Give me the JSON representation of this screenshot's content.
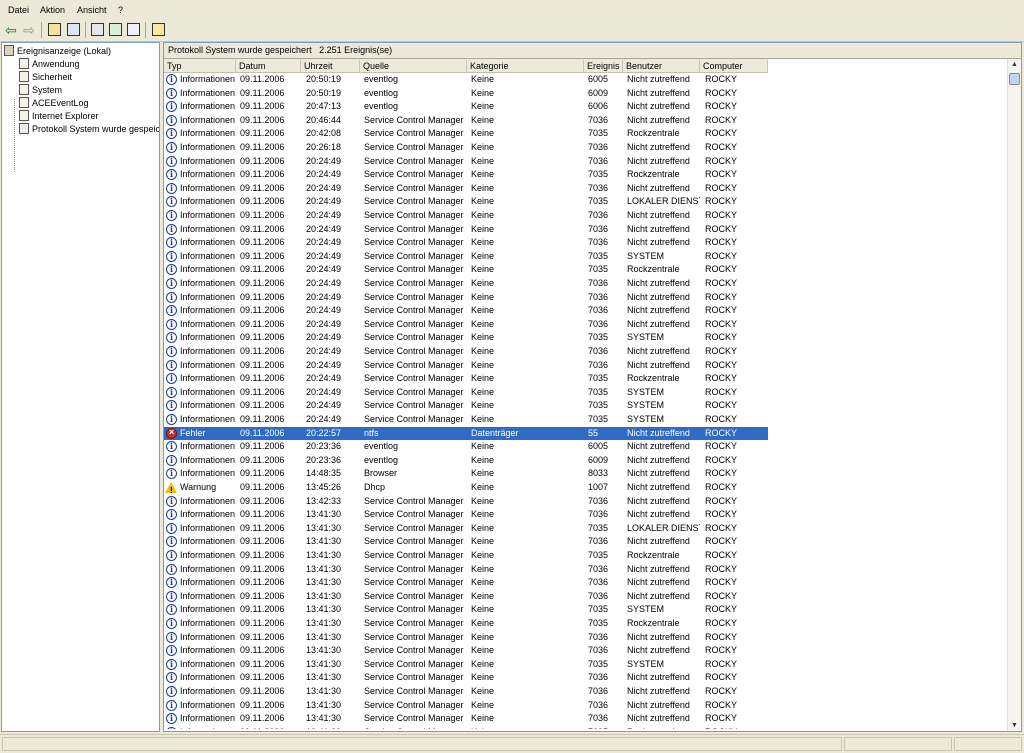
{
  "menu": [
    "Datei",
    "Aktion",
    "Ansicht",
    "?"
  ],
  "toolbar_icons": [
    "back-arrow-icon",
    "forward-arrow-icon",
    "up-folder-icon",
    "show-hide-tree-icon",
    "properties-icon",
    "refresh-icon",
    "export-list-icon",
    "help-icon"
  ],
  "tree": {
    "root": "Ereignisanzeige (Lokal)",
    "items": [
      "Anwendung",
      "Sicherheit",
      "System",
      "ACEEventLog",
      "Internet Explorer",
      "Protokoll System wurde gespeich"
    ]
  },
  "panel": {
    "title": "Protokoll System wurde gespeichert",
    "count": "2.251 Ereignis(se)"
  },
  "columns": [
    "Typ",
    "Datum",
    "Uhrzeit",
    "Quelle",
    "Kategorie",
    "Ereignis",
    "Benutzer",
    "Computer"
  ],
  "rows": [
    [
      "i",
      "Informationen",
      "09.11.2006",
      "20:50:19",
      "eventlog",
      "Keine",
      "6005",
      "Nicht zutreffend",
      "ROCKY"
    ],
    [
      "i",
      "Informationen",
      "09.11.2006",
      "20:50:19",
      "eventlog",
      "Keine",
      "6009",
      "Nicht zutreffend",
      "ROCKY"
    ],
    [
      "i",
      "Informationen",
      "09.11.2006",
      "20:47:13",
      "eventlog",
      "Keine",
      "6006",
      "Nicht zutreffend",
      "ROCKY"
    ],
    [
      "i",
      "Informationen",
      "09.11.2006",
      "20:46:44",
      "Service Control Manager",
      "Keine",
      "7036",
      "Nicht zutreffend",
      "ROCKY"
    ],
    [
      "i",
      "Informationen",
      "09.11.2006",
      "20:42:08",
      "Service Control Manager",
      "Keine",
      "7035",
      "Rockzentrale",
      "ROCKY"
    ],
    [
      "i",
      "Informationen",
      "09.11.2006",
      "20:26:18",
      "Service Control Manager",
      "Keine",
      "7036",
      "Nicht zutreffend",
      "ROCKY"
    ],
    [
      "i",
      "Informationen",
      "09.11.2006",
      "20:24:49",
      "Service Control Manager",
      "Keine",
      "7036",
      "Nicht zutreffend",
      "ROCKY"
    ],
    [
      "i",
      "Informationen",
      "09.11.2006",
      "20:24:49",
      "Service Control Manager",
      "Keine",
      "7035",
      "Rockzentrale",
      "ROCKY"
    ],
    [
      "i",
      "Informationen",
      "09.11.2006",
      "20:24:49",
      "Service Control Manager",
      "Keine",
      "7036",
      "Nicht zutreffend",
      "ROCKY"
    ],
    [
      "i",
      "Informationen",
      "09.11.2006",
      "20:24:49",
      "Service Control Manager",
      "Keine",
      "7035",
      "LOKALER DIENST",
      "ROCKY"
    ],
    [
      "i",
      "Informationen",
      "09.11.2006",
      "20:24:49",
      "Service Control Manager",
      "Keine",
      "7036",
      "Nicht zutreffend",
      "ROCKY"
    ],
    [
      "i",
      "Informationen",
      "09.11.2006",
      "20:24:49",
      "Service Control Manager",
      "Keine",
      "7036",
      "Nicht zutreffend",
      "ROCKY"
    ],
    [
      "i",
      "Informationen",
      "09.11.2006",
      "20:24:49",
      "Service Control Manager",
      "Keine",
      "7036",
      "Nicht zutreffend",
      "ROCKY"
    ],
    [
      "i",
      "Informationen",
      "09.11.2006",
      "20:24:49",
      "Service Control Manager",
      "Keine",
      "7035",
      "SYSTEM",
      "ROCKY"
    ],
    [
      "i",
      "Informationen",
      "09.11.2006",
      "20:24:49",
      "Service Control Manager",
      "Keine",
      "7035",
      "Rockzentrale",
      "ROCKY"
    ],
    [
      "i",
      "Informationen",
      "09.11.2006",
      "20:24:49",
      "Service Control Manager",
      "Keine",
      "7036",
      "Nicht zutreffend",
      "ROCKY"
    ],
    [
      "i",
      "Informationen",
      "09.11.2006",
      "20:24:49",
      "Service Control Manager",
      "Keine",
      "7036",
      "Nicht zutreffend",
      "ROCKY"
    ],
    [
      "i",
      "Informationen",
      "09.11.2006",
      "20:24:49",
      "Service Control Manager",
      "Keine",
      "7036",
      "Nicht zutreffend",
      "ROCKY"
    ],
    [
      "i",
      "Informationen",
      "09.11.2006",
      "20:24:49",
      "Service Control Manager",
      "Keine",
      "7036",
      "Nicht zutreffend",
      "ROCKY"
    ],
    [
      "i",
      "Informationen",
      "09.11.2006",
      "20:24:49",
      "Service Control Manager",
      "Keine",
      "7035",
      "SYSTEM",
      "ROCKY"
    ],
    [
      "i",
      "Informationen",
      "09.11.2006",
      "20:24:49",
      "Service Control Manager",
      "Keine",
      "7036",
      "Nicht zutreffend",
      "ROCKY"
    ],
    [
      "i",
      "Informationen",
      "09.11.2006",
      "20:24:49",
      "Service Control Manager",
      "Keine",
      "7036",
      "Nicht zutreffend",
      "ROCKY"
    ],
    [
      "i",
      "Informationen",
      "09.11.2006",
      "20:24:49",
      "Service Control Manager",
      "Keine",
      "7035",
      "Rockzentrale",
      "ROCKY"
    ],
    [
      "i",
      "Informationen",
      "09.11.2006",
      "20:24:49",
      "Service Control Manager",
      "Keine",
      "7035",
      "SYSTEM",
      "ROCKY"
    ],
    [
      "i",
      "Informationen",
      "09.11.2006",
      "20:24:49",
      "Service Control Manager",
      "Keine",
      "7035",
      "SYSTEM",
      "ROCKY"
    ],
    [
      "i",
      "Informationen",
      "09.11.2006",
      "20:24:49",
      "Service Control Manager",
      "Keine",
      "7035",
      "SYSTEM",
      "ROCKY"
    ],
    [
      "e",
      "Fehler",
      "09.11.2006",
      "20:22:57",
      "ntfs",
      "Datenträger",
      "55",
      "Nicht zutreffend",
      "ROCKY"
    ],
    [
      "i",
      "Informationen",
      "09.11.2006",
      "20:23:36",
      "eventlog",
      "Keine",
      "6005",
      "Nicht zutreffend",
      "ROCKY"
    ],
    [
      "i",
      "Informationen",
      "09.11.2006",
      "20:23:36",
      "eventlog",
      "Keine",
      "6009",
      "Nicht zutreffend",
      "ROCKY"
    ],
    [
      "i",
      "Informationen",
      "09.11.2006",
      "14:48:35",
      "Browser",
      "Keine",
      "8033",
      "Nicht zutreffend",
      "ROCKY"
    ],
    [
      "w",
      "Warnung",
      "09.11.2006",
      "13:45:26",
      "Dhcp",
      "Keine",
      "1007",
      "Nicht zutreffend",
      "ROCKY"
    ],
    [
      "i",
      "Informationen",
      "09.11.2006",
      "13:42:33",
      "Service Control Manager",
      "Keine",
      "7036",
      "Nicht zutreffend",
      "ROCKY"
    ],
    [
      "i",
      "Informationen",
      "09.11.2006",
      "13:41:30",
      "Service Control Manager",
      "Keine",
      "7036",
      "Nicht zutreffend",
      "ROCKY"
    ],
    [
      "i",
      "Informationen",
      "09.11.2006",
      "13:41:30",
      "Service Control Manager",
      "Keine",
      "7035",
      "LOKALER DIENST",
      "ROCKY"
    ],
    [
      "i",
      "Informationen",
      "09.11.2006",
      "13:41:30",
      "Service Control Manager",
      "Keine",
      "7036",
      "Nicht zutreffend",
      "ROCKY"
    ],
    [
      "i",
      "Informationen",
      "09.11.2006",
      "13:41:30",
      "Service Control Manager",
      "Keine",
      "7035",
      "Rockzentrale",
      "ROCKY"
    ],
    [
      "i",
      "Informationen",
      "09.11.2006",
      "13:41:30",
      "Service Control Manager",
      "Keine",
      "7036",
      "Nicht zutreffend",
      "ROCKY"
    ],
    [
      "i",
      "Informationen",
      "09.11.2006",
      "13:41:30",
      "Service Control Manager",
      "Keine",
      "7036",
      "Nicht zutreffend",
      "ROCKY"
    ],
    [
      "i",
      "Informationen",
      "09.11.2006",
      "13:41:30",
      "Service Control Manager",
      "Keine",
      "7036",
      "Nicht zutreffend",
      "ROCKY"
    ],
    [
      "i",
      "Informationen",
      "09.11.2006",
      "13:41:30",
      "Service Control Manager",
      "Keine",
      "7035",
      "SYSTEM",
      "ROCKY"
    ],
    [
      "i",
      "Informationen",
      "09.11.2006",
      "13:41:30",
      "Service Control Manager",
      "Keine",
      "7035",
      "Rockzentrale",
      "ROCKY"
    ],
    [
      "i",
      "Informationen",
      "09.11.2006",
      "13:41:30",
      "Service Control Manager",
      "Keine",
      "7036",
      "Nicht zutreffend",
      "ROCKY"
    ],
    [
      "i",
      "Informationen",
      "09.11.2006",
      "13:41:30",
      "Service Control Manager",
      "Keine",
      "7036",
      "Nicht zutreffend",
      "ROCKY"
    ],
    [
      "i",
      "Informationen",
      "09.11.2006",
      "13:41:30",
      "Service Control Manager",
      "Keine",
      "7035",
      "SYSTEM",
      "ROCKY"
    ],
    [
      "i",
      "Informationen",
      "09.11.2006",
      "13:41:30",
      "Service Control Manager",
      "Keine",
      "7036",
      "Nicht zutreffend",
      "ROCKY"
    ],
    [
      "i",
      "Informationen",
      "09.11.2006",
      "13:41:30",
      "Service Control Manager",
      "Keine",
      "7036",
      "Nicht zutreffend",
      "ROCKY"
    ],
    [
      "i",
      "Informationen",
      "09.11.2006",
      "13:41:30",
      "Service Control Manager",
      "Keine",
      "7036",
      "Nicht zutreffend",
      "ROCKY"
    ],
    [
      "i",
      "Informationen",
      "09.11.2006",
      "13:41:30",
      "Service Control Manager",
      "Keine",
      "7036",
      "Nicht zutreffend",
      "ROCKY"
    ],
    [
      "i",
      "Informationen",
      "09.11.2006",
      "13:41:30",
      "Service Control Manager",
      "Keine",
      "7035",
      "Rockzentrale",
      "ROCKY"
    ]
  ],
  "selected_row": 26,
  "colors": {
    "selection": "#316ac5",
    "chrome": "#ece9d8",
    "border": "#7f9db9"
  }
}
